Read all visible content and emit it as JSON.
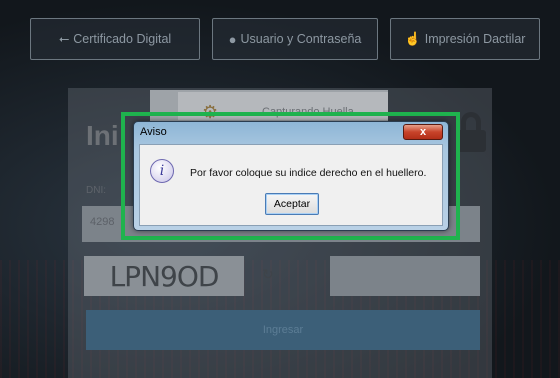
{
  "auth_options": {
    "certificate": {
      "label": "Certificado Digital",
      "icon": "usb-icon"
    },
    "user_password": {
      "label": "Usuario y Contraseña",
      "icon": "user-circle-icon"
    },
    "fingerprint": {
      "label": "Impresión Dactilar",
      "icon": "hand-pointer-icon"
    }
  },
  "login_form": {
    "title": "Ini",
    "dni_label": "DNI:",
    "dni_value": "4298",
    "captcha_text": "LPN9OD",
    "submit_label": "Ingresar"
  },
  "capture_window": {
    "title": "Capturando Huella"
  },
  "dialog": {
    "title": "Aviso",
    "close_label": "x",
    "message": "Por favor coloque su indice derecho en el huellero.",
    "ok_label": "Aceptar"
  },
  "colors": {
    "highlight": "#1fb34e",
    "submit_button": "#3c5f78",
    "dialog_close": "#c8432a"
  }
}
